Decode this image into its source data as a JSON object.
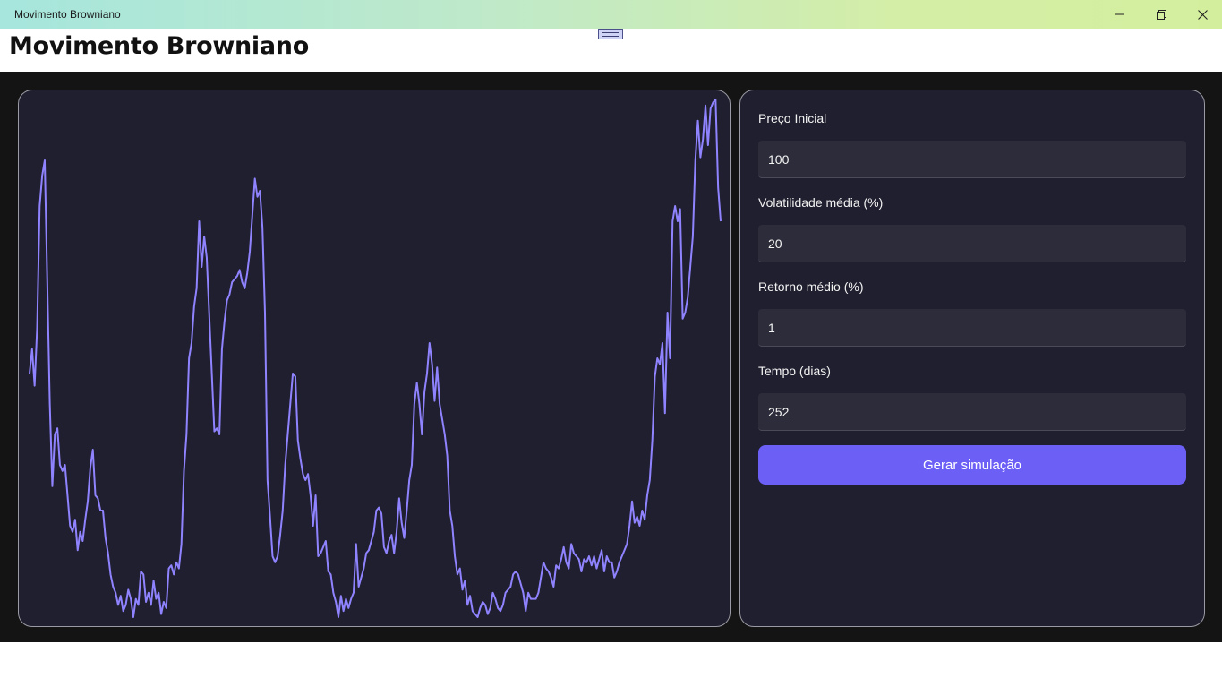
{
  "window": {
    "title": "Movimento Browniano",
    "controls": [
      "minimize-icon",
      "maximize-icon",
      "close-icon"
    ]
  },
  "app": {
    "heading": "Movimento Browniano"
  },
  "form": {
    "fields": [
      {
        "label": "Preço Inicial",
        "value": "100"
      },
      {
        "label": "Volatilidade média (%)",
        "value": "20"
      },
      {
        "label": "Retorno médio (%)",
        "value": "1"
      },
      {
        "label": "Tempo (dias)",
        "value": "252"
      }
    ],
    "button_label": "Gerar simulação"
  },
  "colors": {
    "accent": "#6b5ff6",
    "line": "#8f83ff",
    "panel": "#201f2f",
    "background": "#141414"
  },
  "chart_data": {
    "type": "line",
    "title": "",
    "xlabel": "",
    "ylabel": "",
    "grid": false,
    "legend": "none",
    "series": [
      {
        "values": [
          80,
          88,
          76,
          95,
          135,
          145,
          150,
          110,
          70,
          43,
          60,
          62,
          50,
          48,
          50,
          40,
          30,
          28,
          32,
          22,
          28,
          25,
          32,
          38,
          49,
          55,
          40,
          39,
          35,
          35,
          26,
          21,
          14,
          10,
          8,
          4,
          7,
          2,
          4,
          9,
          6,
          0,
          6,
          4,
          15,
          14,
          5,
          8,
          4,
          12,
          6,
          8,
          1,
          5,
          3,
          16,
          17,
          14,
          18,
          16,
          24,
          48,
          60,
          85,
          90,
          102,
          108,
          130,
          115,
          125,
          118,
          99,
          80,
          61,
          62,
          60,
          88,
          97,
          104,
          106,
          110,
          111,
          112,
          114,
          110,
          108,
          113,
          120,
          132,
          144,
          138,
          140,
          128,
          100,
          45,
          33,
          20,
          18,
          20,
          27,
          35,
          50,
          60,
          70,
          80,
          79,
          58,
          52,
          47,
          45,
          47,
          40,
          30,
          40,
          20,
          21,
          23,
          25,
          15,
          14,
          8,
          5,
          0,
          7,
          2,
          6,
          3,
          6,
          8,
          24,
          10,
          13,
          16,
          21,
          22,
          25,
          28,
          35,
          36,
          34,
          23,
          21,
          25,
          27,
          21,
          28,
          39,
          31,
          26,
          35,
          45,
          50,
          70,
          77,
          70,
          60,
          74,
          80,
          90,
          83,
          71,
          82,
          70,
          65,
          60,
          53,
          35,
          30,
          20,
          14,
          16,
          9,
          12,
          4,
          7,
          2,
          1,
          0,
          3,
          5,
          4,
          1,
          3,
          8,
          6,
          3,
          2,
          4,
          8,
          9,
          10,
          14,
          15,
          14,
          11,
          8,
          2,
          8,
          6,
          6,
          6,
          8,
          13,
          18,
          16,
          15,
          13,
          10,
          17,
          16,
          19,
          23,
          18,
          16,
          24,
          21,
          20,
          19,
          15,
          19,
          18,
          20,
          17,
          20,
          16,
          19,
          22,
          15,
          20,
          18,
          18,
          13,
          15,
          18,
          20,
          22,
          24,
          30,
          38,
          31,
          33,
          30,
          35,
          32,
          40,
          45,
          58,
          79,
          85,
          83,
          90,
          67,
          100,
          85,
          130,
          135,
          130,
          134,
          98,
          100,
          105,
          115,
          125,
          150,
          163,
          151,
          157,
          168,
          155,
          167,
          169,
          170,
          141,
          130
        ]
      }
    ],
    "ylim": [
      0,
      170
    ]
  }
}
